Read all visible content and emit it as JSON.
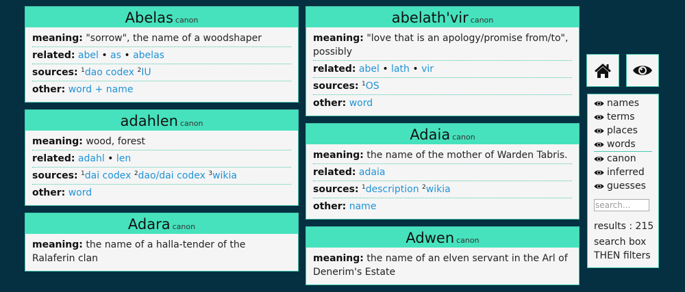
{
  "labels": {
    "meaning": "meaning:",
    "related": "related:",
    "sources": "sources:",
    "other": "other:"
  },
  "columns": {
    "left": [
      {
        "title": "Abelas",
        "tag": "canon",
        "meaning": "\"sorrow\", the name of a woodshaper",
        "related": [
          "abel",
          "as",
          "abelas"
        ],
        "sources": [
          {
            "n": "1",
            "text": "dao codex"
          },
          {
            "n": "2",
            "text": "IU"
          }
        ],
        "other": "word + name"
      },
      {
        "title": "adahlen",
        "tag": "canon",
        "meaning": "wood, forest",
        "related": [
          "adahl",
          "len"
        ],
        "sources": [
          {
            "n": "1",
            "text": "dai codex"
          },
          {
            "n": "2",
            "text": "dao/dai codex"
          },
          {
            "n": "3",
            "text": "wikia"
          }
        ],
        "other": "word"
      },
      {
        "title": "Adara",
        "tag": "canon",
        "meaning": "the name of a halla-tender of the Ralaferin clan"
      }
    ],
    "right": [
      {
        "title": "abelath'vir",
        "tag": "canon",
        "meaning": "\"love that is an apology/promise from/to\", possibly",
        "related": [
          "abel",
          "lath",
          "vir"
        ],
        "sources": [
          {
            "n": "1",
            "text": "OS"
          }
        ],
        "other": "word"
      },
      {
        "title": "Adaia",
        "tag": "canon",
        "meaning": "the name of the mother of Warden Tabris.",
        "related": [
          "adaia"
        ],
        "sources": [
          {
            "n": "1",
            "text": "description"
          },
          {
            "n": "2",
            "text": "wikia"
          }
        ],
        "other": "name"
      },
      {
        "title": "Adwen",
        "tag": "canon",
        "meaning": "the name of an elven servant in the Arl of Denerim's Estate"
      }
    ]
  },
  "toolbar": {
    "home_icon": "home-icon",
    "eye_icon": "eye-icon"
  },
  "filters": {
    "groups": [
      [
        "names",
        "terms",
        "places",
        "words"
      ],
      [
        "canon",
        "inferred",
        "guesses"
      ]
    ]
  },
  "search": {
    "placeholder": "search..."
  },
  "results": {
    "text": "results : 215"
  },
  "note": {
    "text": "search box THEN filters"
  },
  "colors": {
    "background": "#053041",
    "accent": "#46e2bd",
    "link": "#1f93d6",
    "card": "#f5f5f5"
  }
}
